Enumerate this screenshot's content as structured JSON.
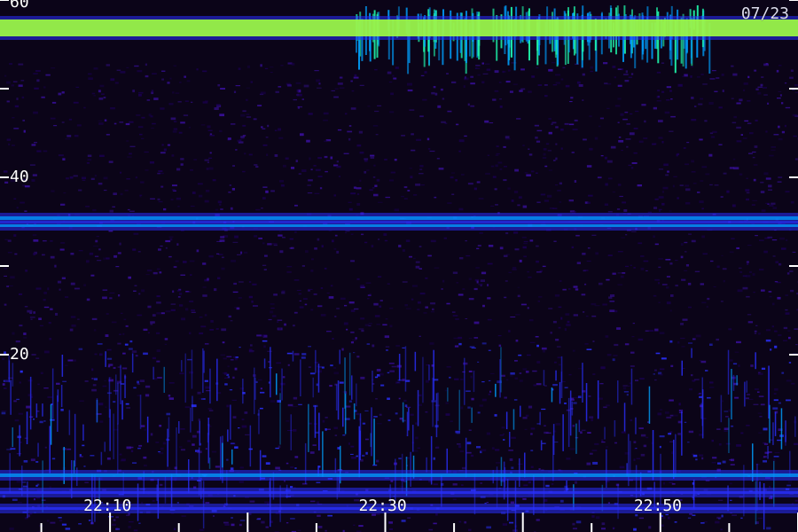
{
  "chart_data": {
    "type": "heatmap",
    "title": "",
    "date_label": "07/23",
    "x": {
      "start_minutes": 1322,
      "end_minutes": 1380,
      "major_ticks": [
        "22:10",
        "22:30",
        "22:50"
      ],
      "major_tick_minutes": [
        1330,
        1350,
        1370
      ],
      "minor_tick_step_minutes": 5
    },
    "y": {
      "range": [
        0,
        60
      ],
      "tick_labels": [
        "60",
        "40",
        "20"
      ],
      "tick_values": [
        60,
        40,
        20
      ],
      "minor_tick_values": [
        50,
        30
      ]
    },
    "bands": [
      {
        "name": "",
        "y_from": 55.9,
        "y_to": 57.8,
        "intensity": "high"
      },
      {
        "name": "",
        "y_from": 35.2,
        "y_to": 35.6,
        "intensity": "medium"
      },
      {
        "name": "",
        "y_from": 34.4,
        "y_to": 34.7,
        "intensity": "medium"
      },
      {
        "name": "",
        "y_from": 6.2,
        "y_to": 6.6,
        "intensity": "medium"
      },
      {
        "name": "",
        "y_from": 4.3,
        "y_to": 4.6,
        "intensity": "low"
      },
      {
        "name": "",
        "y_from": 2.5,
        "y_to": 2.8,
        "intensity": "low"
      }
    ],
    "colormap": [
      "#000000",
      "#1a0050",
      "#3a10a0",
      "#2a30ff",
      "#00a0ff",
      "#20ffb0",
      "#a0ff40"
    ]
  }
}
